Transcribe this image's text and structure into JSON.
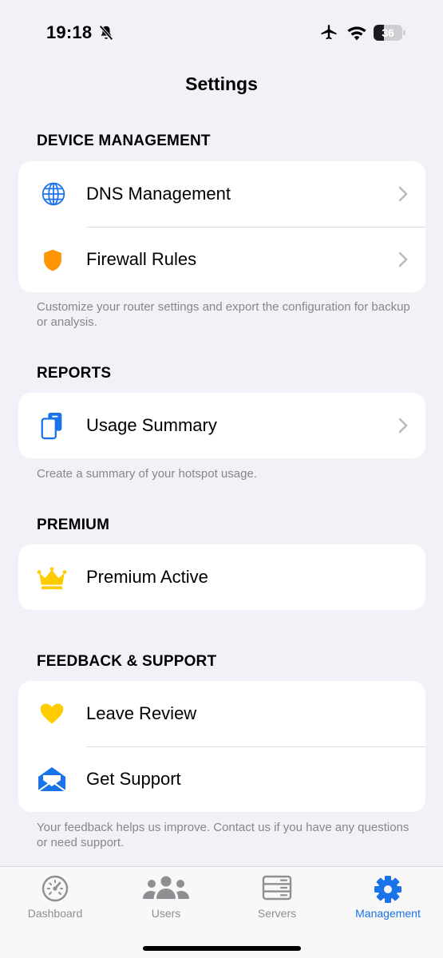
{
  "status_bar": {
    "time": "19:18",
    "battery": "36",
    "battery_level": 0.36
  },
  "title": "Settings",
  "sections": {
    "device": {
      "header": "DEVICE MANAGEMENT",
      "items": [
        {
          "label": "DNS Management",
          "icon": "globe-icon"
        },
        {
          "label": "Firewall Rules",
          "icon": "shield-icon"
        }
      ],
      "footnote": "Customize your router settings and export the configuration for backup or analysis."
    },
    "reports": {
      "header": "REPORTS",
      "items": [
        {
          "label": "Usage Summary",
          "icon": "documents-icon"
        }
      ],
      "footnote": "Create a summary of your hotspot usage."
    },
    "premium": {
      "header": "PREMIUM",
      "items": [
        {
          "label": "Premium Active",
          "icon": "crown-icon"
        }
      ]
    },
    "feedback": {
      "header": "FEEDBACK & SUPPORT",
      "items": [
        {
          "label": "Leave Review",
          "icon": "heart-icon"
        },
        {
          "label": "Get Support",
          "icon": "envelope-icon"
        }
      ],
      "footnote": "Your feedback helps us improve. Contact us if you have any questions or need support."
    }
  },
  "tabs": [
    {
      "label": "Dashboard",
      "icon": "gauge-icon",
      "active": false
    },
    {
      "label": "Users",
      "icon": "users-icon",
      "active": false
    },
    {
      "label": "Servers",
      "icon": "server-icon",
      "active": false
    },
    {
      "label": "Management",
      "icon": "gear-icon",
      "active": true
    }
  ],
  "colors": {
    "accent": "#1a73e8",
    "shield": "#ff9500",
    "crown": "#ffcc00",
    "heart": "#ffcc00",
    "background": "#f2f1f7"
  }
}
